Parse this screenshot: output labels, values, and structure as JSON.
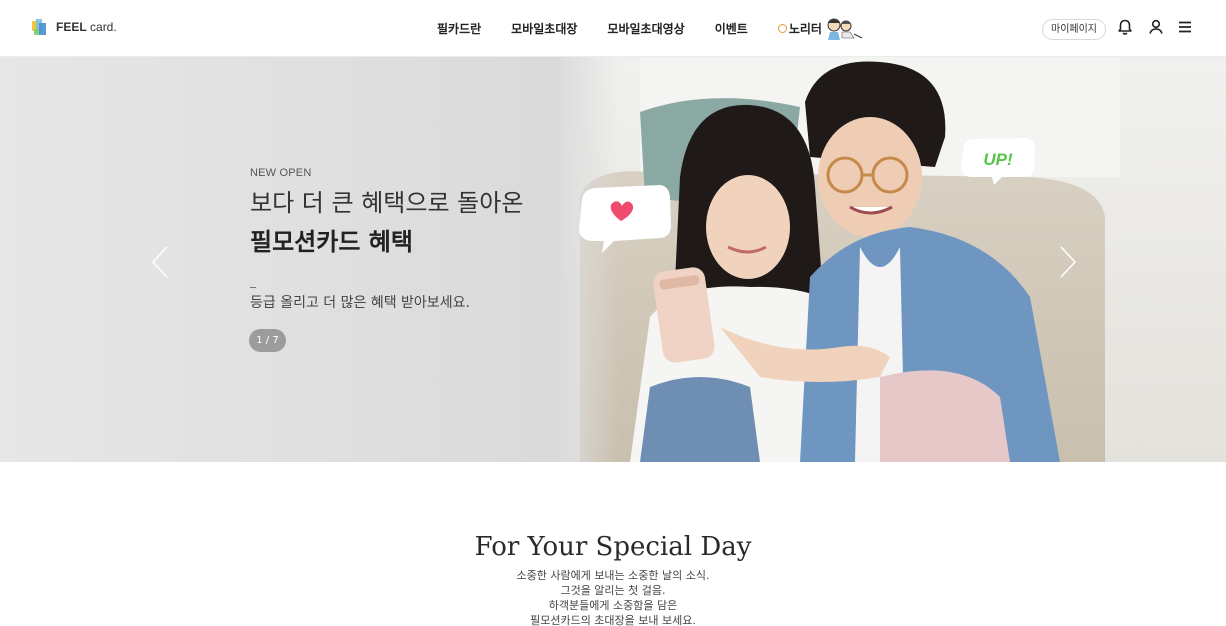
{
  "header": {
    "logo_bold": "FEEL",
    "logo_text": "card.",
    "nav": [
      "필카드란",
      "모바일초대장",
      "모바일초대영상",
      "이벤트"
    ],
    "nav_active": "이벤트",
    "norita": "노리터",
    "mypage": "마이페이지",
    "icons": [
      "bell-icon",
      "user-icon",
      "menu-icon"
    ],
    "highlight_color": "#f3ea6b"
  },
  "hero": {
    "new_open": "NEW OPEN",
    "line1": "보다 더 큰 혜택으로 돌아온",
    "line2": "필모션카드 혜택",
    "sub": "등급 올리고 더 많은 혜택 받아보세요.",
    "pager": "1 / 7",
    "bubble_right": "UP!",
    "accent_green": "#57c44a",
    "accent_pink": "#ef4b6f"
  },
  "section": {
    "title": "For Your Special Day",
    "lines": [
      "소중한 사람에게 보내는 소중한 날의 소식.",
      "그것을 알리는 첫 걸음.",
      "하객분들에게 소중함을 담은",
      "필모션카드의 초대장을 보내 보세요."
    ]
  }
}
